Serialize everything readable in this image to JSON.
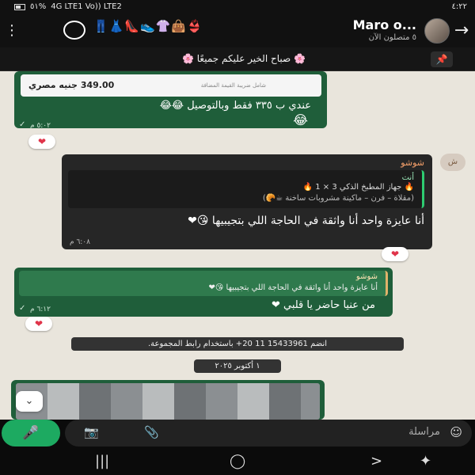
{
  "status": {
    "time": "٤:٢٢",
    "battery": "٥١%",
    "network": "4G LTE1 Vo)) LTE2"
  },
  "header": {
    "title": "Maro o...",
    "subtitle": "٥ متصلون الآن",
    "emojis": "👖👗👠👟👚👜👙"
  },
  "pinned": {
    "text": "🌸 صباح الخير عليكم جميعًا 🌸"
  },
  "messages": {
    "m1": {
      "card_price": "349.00 جنيه مصري",
      "card_sub": "شامل ضريبة القيمة المضافة",
      "text": "عندي ب ٣٣٥ فقط وبالتوصيل 😂😂",
      "face": "😂",
      "time": "٥:٠٢ م",
      "reaction": "❤"
    },
    "m2": {
      "avatar": "ش",
      "sender": "شوشو",
      "quote_sender": "أنت",
      "quote_line1": "🔥 جهاز المطبخ الذكي 3 × 1 🔥",
      "quote_line2": "(مقلاة – فرن – ماكينة مشروبات ساخنة ☕🥐)",
      "text": "أنا عايزة واحد أنا واثقة في الحاجة اللي بتجيبيها 😘❤",
      "time": "٦:٠٨ م",
      "reaction": "❤"
    },
    "m3": {
      "quote_sender": "شوشو",
      "quote_line1": "أنا عايزة واحد أنا واثقة في الحاجة اللي بتجيبيها 😘❤",
      "text": "من عنيا حاضر يا قلبي ❤",
      "time": "٦:١٢ م",
      "reaction": "❤"
    }
  },
  "system": {
    "join": "انضم 15433961 11 20+ باستخدام رابط المجموعة.",
    "date": "١ أكتوبر ٢٠٢٥"
  },
  "input": {
    "placeholder": "مراسلة"
  }
}
